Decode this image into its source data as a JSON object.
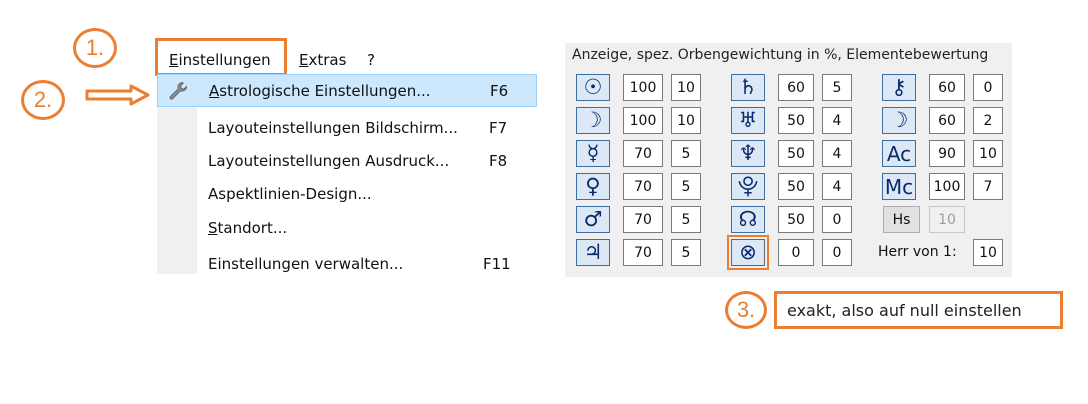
{
  "menubar": {
    "items": [
      "Einstellungen",
      "Extras",
      "?"
    ]
  },
  "dropdown": {
    "items": [
      {
        "label": "Astrologische Einstellungen...",
        "shortcut": "F6"
      },
      {
        "label": "Layouteinstellungen Bildschirm...",
        "shortcut": "F7"
      },
      {
        "label": "Layouteinstellungen Ausdruck...",
        "shortcut": "F8"
      },
      {
        "label": "Aspektlinien-Design...",
        "shortcut": ""
      },
      {
        "label": "Standort...",
        "shortcut": ""
      },
      {
        "label": "Einstellungen verwalten...",
        "shortcut": "F11"
      }
    ]
  },
  "annotations": {
    "step1": "1.",
    "step2": "2.",
    "step3": "3.",
    "step3_text": "exakt, also auf null einstellen"
  },
  "panel": {
    "title": "Anzeige, spez. Orbengewichtung in %, Elementebewertung",
    "col1": [
      {
        "icon": "sun-icon",
        "glyph": "☉",
        "a": "100",
        "b": "10"
      },
      {
        "icon": "moon-icon",
        "glyph": "☽",
        "a": "100",
        "b": "10"
      },
      {
        "icon": "mercury-icon",
        "glyph": "☿",
        "a": "70",
        "b": "5"
      },
      {
        "icon": "venus-icon",
        "glyph": "♀",
        "a": "70",
        "b": "5"
      },
      {
        "icon": "mars-icon",
        "glyph": "♂",
        "a": "70",
        "b": "5"
      },
      {
        "icon": "jupiter-icon",
        "glyph": "♃",
        "a": "70",
        "b": "5"
      }
    ],
    "col2": [
      {
        "icon": "saturn-icon",
        "glyph": "♄",
        "a": "60",
        "b": "5"
      },
      {
        "icon": "uranus-icon",
        "glyph": "♅",
        "a": "50",
        "b": "4"
      },
      {
        "icon": "neptune-icon",
        "glyph": "♆",
        "a": "50",
        "b": "4"
      },
      {
        "icon": "pluto-icon",
        "glyph": "⯓",
        "a": "50",
        "b": "4"
      },
      {
        "icon": "node-icon",
        "glyph": "☊",
        "a": "50",
        "b": "0"
      },
      {
        "icon": "part-of-fortune-icon",
        "glyph": "⊗",
        "a": "0",
        "b": "0"
      }
    ],
    "col3": [
      {
        "icon": "chiron-icon",
        "glyph": "⚷",
        "a": "60",
        "b": "0"
      },
      {
        "icon": "lilith-icon",
        "glyph": "☽",
        "a": "60",
        "b": "2"
      },
      {
        "icon": "ascendant-icon",
        "glyph": "Ac",
        "a": "90",
        "b": "10"
      },
      {
        "icon": "midheaven-icon",
        "glyph": "Mc",
        "a": "100",
        "b": "7"
      }
    ],
    "hs_label": "Hs",
    "hs_value": "10",
    "herr_label": "Herr von 1:",
    "herr_value": "10"
  },
  "colors": {
    "accent": "#ED7D31",
    "highlight": "#cce8ff"
  }
}
